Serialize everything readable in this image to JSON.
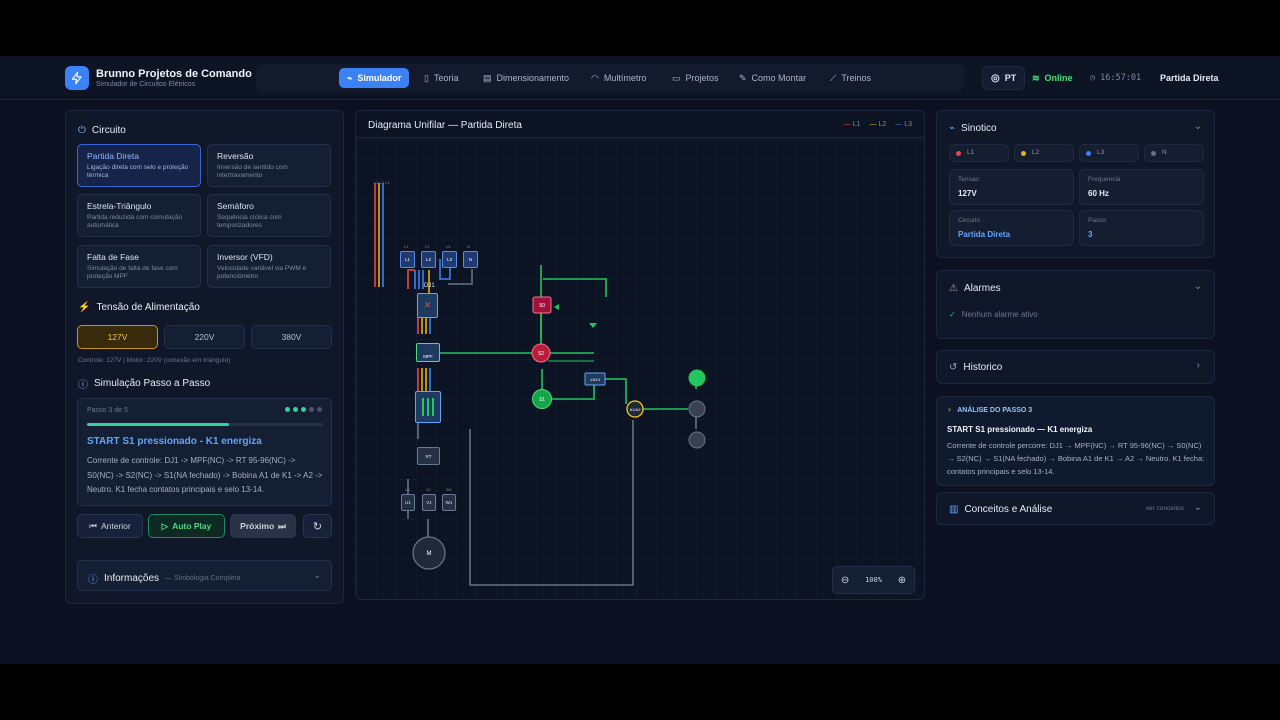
{
  "header": {
    "brand_title": "Brunno Projetos de Comando",
    "brand_subtitle": "Simulador de Circuitos Elétricos",
    "nav": [
      "Simulador",
      "Teoria",
      "Dimensionamento",
      "Multímetro",
      "Projetos",
      "Como Montar",
      "Treinos"
    ],
    "active_nav": "Simulador",
    "lang": "PT",
    "status": "Online",
    "time": "16:57:01",
    "current": "Partida Direta"
  },
  "left": {
    "circuit_title": "Circuito",
    "circuits": [
      {
        "name": "Partida Direta",
        "desc": "Ligação direta com selo e proteção térmica",
        "selected": true
      },
      {
        "name": "Reversão",
        "desc": "Inversão de sentido com intertravamento",
        "selected": false
      },
      {
        "name": "Estrela-Triângulo",
        "desc": "Partida reduzida com comutação automática",
        "selected": false
      },
      {
        "name": "Semáforo",
        "desc": "Sequência cíclica com temporizadores",
        "selected": false
      },
      {
        "name": "Falta de Fase",
        "desc": "Simulação de falta de fase com proteção MPF",
        "selected": false
      },
      {
        "name": "Inversor (VFD)",
        "desc": "Velocidade variável via PWM e potenciômetro",
        "selected": false
      }
    ],
    "voltage_title": "Tensão de Alimentação",
    "voltages": [
      "127V",
      "220V",
      "380V"
    ],
    "voltage_selected": "127V",
    "voltage_note": "Controle: 127V | Motor: 220V (conexão em triângulo)",
    "step_title": "Simulação Passo a Passo",
    "step_counter": "Passo 3 de 5",
    "step_progress": 0.6,
    "step_heading": "START S1 pressionado - K1 energiza",
    "step_text": "Corrente de controle: DJ1 -> MPF(NC) -> RT 95-96(NC) -> S0(NC) -> S2(NC) -> S1(NA fechado) -> Bobina A1 de K1 -> A2 -> Neutro. K1 fecha contatos principais e selo 13-14.",
    "btn_prev": "Anterior",
    "btn_auto": "Auto Play",
    "btn_next": "Próximo",
    "info_title": "Informações",
    "info_sub": "— Simbologia Completa"
  },
  "diagram": {
    "title": "Diagrama Unifilar — Partida Direta",
    "legend": [
      {
        "name": "L1",
        "color": "#ef4444"
      },
      {
        "name": "L2",
        "color": "#eab308"
      },
      {
        "name": "L3",
        "color": "#3b82f6"
      }
    ],
    "zoom": "100%",
    "labels": {
      "l123": "L1 L2 L3",
      "top_nodes": [
        "L1",
        "L2",
        "L3",
        "N"
      ],
      "top_tags": [
        "L1",
        "L2",
        "L3",
        "N"
      ],
      "dj1": "DJ1",
      "mpf": "MPF",
      "rt": "RT",
      "m": "M",
      "s0": "S0",
      "s2": "S2",
      "s1": "S1",
      "k1": "13/14",
      "a1a2": "A1/A2",
      "bottom_nodes": [
        "U1",
        "V1",
        "W1"
      ],
      "bottom_tags": [
        "U1",
        "V1",
        "W1"
      ]
    }
  },
  "right": {
    "sinotico_title": "Sinotico",
    "phases": [
      {
        "name": "L1",
        "color": "#ef4444"
      },
      {
        "name": "L2",
        "color": "#eab308"
      },
      {
        "name": "L3",
        "color": "#3b82f6"
      },
      {
        "name": "N",
        "color": "#6b7280"
      }
    ],
    "tiles": [
      {
        "label": "Tensao",
        "value": "127V",
        "accent": false
      },
      {
        "label": "Frequencia",
        "value": "60 Hz",
        "accent": false
      },
      {
        "label": "Circuito",
        "value": "Partida Direta",
        "accent": true
      },
      {
        "label": "Passo",
        "value": "3",
        "accent": true
      }
    ],
    "alarm_title": "Alarmes",
    "alarm_text": "Nenhum alarme ativo",
    "history_title": "Historico",
    "analysis_label": "ANÁLISE DO PASSO 3",
    "analysis_heading": "START S1 pressionado — K1 energiza",
    "analysis_text": "Corrente de controle percorre: DJ1 → MPF(NC) → RT 95-96(NC) → S0(NC) → S2(NC) → S1(NA fechado) → Bobina A1 de K1 → A2 → Neutro. K1 fecha: contatos principais e selo 13-14.",
    "concepts_title": "Conceitos e Análise",
    "concepts_link": "ver conceitos"
  }
}
